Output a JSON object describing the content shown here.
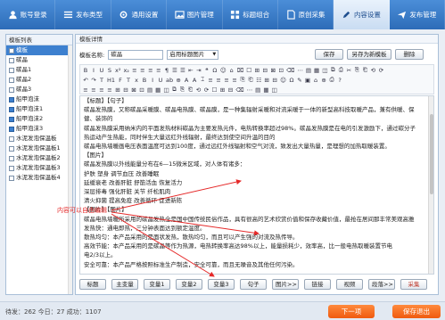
{
  "nav": {
    "items": [
      {
        "label": "账号登录",
        "icon": "user-icon"
      },
      {
        "label": "发布类型",
        "icon": "list-icon"
      },
      {
        "label": "通用设置",
        "icon": "gear-icon"
      },
      {
        "label": "图片管理",
        "icon": "image-icon"
      },
      {
        "label": "标题组合",
        "icon": "grid-icon"
      },
      {
        "label": "原创采集",
        "icon": "document-icon"
      },
      {
        "label": "内容设置",
        "icon": "edit-icon"
      },
      {
        "label": "发布管理",
        "icon": "send-icon"
      }
    ],
    "active_index": 6
  },
  "sidebar": {
    "title": "模板列表",
    "items": [
      {
        "label": "模板",
        "checked": false,
        "selected": true
      },
      {
        "label": "碳晶",
        "checked": false,
        "selected": false
      },
      {
        "label": "碳晶1",
        "checked": false,
        "selected": false
      },
      {
        "label": "碳晶2",
        "checked": false,
        "selected": false
      },
      {
        "label": "碳晶3",
        "checked": false,
        "selected": false
      },
      {
        "label": "船甲泡沫",
        "checked": true,
        "selected": false
      },
      {
        "label": "船甲泡沫1",
        "checked": true,
        "selected": false
      },
      {
        "label": "船甲泡沫2",
        "checked": true,
        "selected": false
      },
      {
        "label": "船甲泡沫3",
        "checked": true,
        "selected": false
      },
      {
        "label": "水泥发泡保温板",
        "checked": false,
        "selected": false
      },
      {
        "label": "水泥发泡保温板1",
        "checked": false,
        "selected": false
      },
      {
        "label": "水泥发泡保温板2",
        "checked": false,
        "selected": false
      },
      {
        "label": "水泥发泡保温板3",
        "checked": false,
        "selected": false
      },
      {
        "label": "水泥发泡保温板4",
        "checked": false,
        "selected": false
      }
    ]
  },
  "detail": {
    "title": "模板详情",
    "name_label": "模板名称:",
    "name_value": "碳晶",
    "image_select": "启用标题图片",
    "save": "保存",
    "save_as": "另存为新模板",
    "delete": "删除"
  },
  "toolbar": {
    "row1": [
      "B",
      "I",
      "U",
      "S",
      "x²",
      "x₂",
      "≡",
      "≡",
      "≡",
      "≡",
      "¶",
      "☰",
      "☰",
      "⇤",
      "⇥",
      "❝",
      "Ω",
      "☺",
      "⌂",
      "⌧",
      "☐",
      "⊞",
      "⊟",
      "⊠",
      "⊡",
      "⌫",
      "⋯",
      "▤",
      "▦",
      "◫",
      "⧉",
      "⎙",
      "✂",
      "⎘",
      "⎗",
      "⟲",
      "⟳"
    ],
    "row2": [
      "↶",
      "↷",
      "T",
      "H1",
      "F",
      "T",
      "x",
      "B",
      "I",
      "U",
      "ab",
      "⊕",
      "A",
      "A",
      "⌶",
      "≡",
      "≡",
      "≡",
      "≡",
      "⎘",
      "⎗",
      "☷",
      "⊞",
      "⊟",
      "☺",
      "Ω",
      "✎",
      "▣",
      "⌂",
      "⊕",
      "⎙",
      "?"
    ],
    "row3": [
      "≡",
      "≡",
      "≡",
      "≡",
      "⊞",
      "⊟",
      "⊠",
      "⊡",
      "▤",
      "▦",
      "◫",
      "⧉",
      "⎘",
      "⎗",
      "⟲",
      "⟳",
      "☐",
      "⊞",
      "⊟",
      "⌫",
      "⋯",
      "▤",
      "▦",
      "◫"
    ]
  },
  "editor": {
    "lines": [
      "【标题】【句子】",
      "碳晶发热膜，又称碳晶采暖膜、碳晶电热膜、碳晶膜，是一种集辐射采暖和对流采暖于一体的新型高科技取暖产品，兼有供暖、保",
      "健、装饰的",
      "碳晶发热膜采用纳米内的平面发热材料碳晶为主要发热元件，电热转换率超过98%。碳晶发热膜是在电的引发激励下，通过碳分子",
      "热运动产生热能，同时伴生大量远红外线辐射，最终达到使空间升温的目的",
      "碳晶电热墙暖画电压表面温度可达到100度，通过远红外线辐射和空气对流，致发出大量热量，是理想的加热取暖装置。",
      "【图片】",
      "碳晶发热膜以外线能量分布在6—15微米区域，对人体有诸多：",
      "护肤  塑身  调节血压  改善睡眠",
      "延缓衰老  改善肝脏  舒筋活血  恢复活力",
      "深层排毒  强化肝脏  关节  纤松肌肉",
      "清火抑菌  提高免疫  改善循环  促进新陈",
      "【图片】【图片】",
      "碳晶电热墙暖所采用的碳晶发热全是国中国传统民俗作品，具有很高的艺术欣赏价值和保存收藏价值，最抢在居间那丰常美观高雅",
      "发热快：通电即热，三分钟表面达到额定温度。",
      "散热均匀：本产品采用的是面状发热，散热均匀，而且可以产生强的对流及热传导。",
      "高效节能：本产品采用的是碳晶等作为热源，电热转换率高达98%以上，能量损耗少，效率高，比一般电热取暖装置节电",
      "电2/3以上。",
      "安全可靠：本产品严格按照标准生产制造，安全可靠，而且无噪音及其他任何污染。"
    ]
  },
  "annotation": "内容可以自由编辑",
  "insert_buttons": [
    "标题",
    "主变量",
    "变量1",
    "变量2",
    "变量3",
    "句子",
    "图片>>",
    "链接",
    "视频",
    "段落>>",
    "采集"
  ],
  "status": {
    "text": "待发：262    今日：27    成功：1107"
  },
  "actions": {
    "next": "下一项",
    "save_exit": "保存退出"
  },
  "colors": {
    "nav_blue": "#2d6cb8",
    "selection": "#3d80cf",
    "accent_orange": "#f05a0f",
    "annotation_red": "#e52929"
  }
}
